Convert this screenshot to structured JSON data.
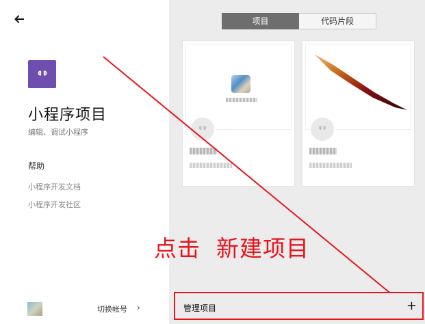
{
  "nav": {
    "back_icon": "arrow-left-icon"
  },
  "app": {
    "logo_icon": "miniprogram-link-icon",
    "logo_color": "#6e4fb0",
    "title": "小程序项目",
    "subtitle": "编辑、调试小程序"
  },
  "help": {
    "heading": "帮助",
    "links": [
      "小程序开发文档",
      "小程序开发社区"
    ]
  },
  "account": {
    "switch_label": "切换帐号",
    "arrow": "›"
  },
  "tabs": [
    {
      "label": "项目",
      "active": true
    },
    {
      "label": "代码片段",
      "active": false
    }
  ],
  "annotation": {
    "text": "点击  新建项目",
    "color": "#e8141c"
  },
  "footer": {
    "manage_label": "管理项目",
    "add_label": "+"
  }
}
